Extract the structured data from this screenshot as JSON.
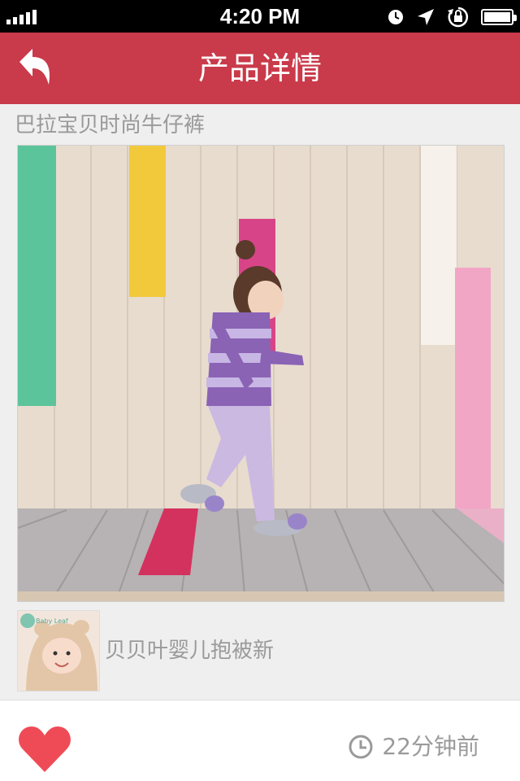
{
  "status_bar": {
    "time": "4:20 PM",
    "icons": [
      "signal-icon",
      "alarm-clock-icon",
      "location-arrow-icon",
      "rotation-lock-icon",
      "battery-icon"
    ]
  },
  "nav": {
    "title": "产品详情",
    "back_icon": "back-arrow-icon"
  },
  "product": {
    "name": "巴拉宝贝时尚牛仔裤",
    "image_icon": "product-photo"
  },
  "related": {
    "title": "贝贝叶婴儿抱被新",
    "thumb_logo_text": "Baby Leaf"
  },
  "bottom": {
    "like_icon": "heart-icon",
    "time_icon": "clock-icon",
    "time_text": "22分钟前"
  },
  "colors": {
    "nav_bg": "#c93a4a",
    "heart": "#ef4b57",
    "muted_text": "#999999"
  }
}
